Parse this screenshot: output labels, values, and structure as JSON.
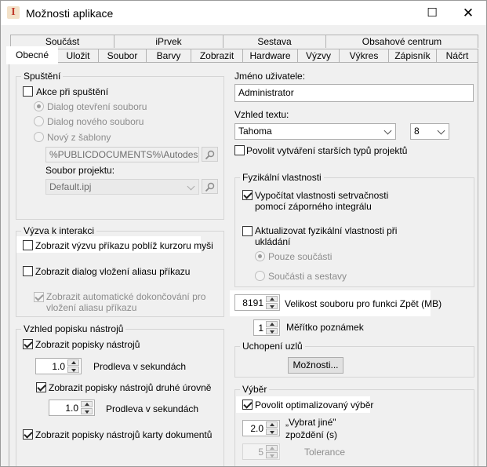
{
  "window": {
    "title": "Možnosti aplikace",
    "maximize_glyph": "☐",
    "close_glyph": "✕",
    "icon": "app-logo-icon"
  },
  "tabs": {
    "row1": [
      "Součást",
      "iPrvek",
      "Sestava",
      "Obsahové centrum"
    ],
    "row2": [
      "Obecné",
      "Uložit",
      "Soubor",
      "Barvy",
      "Zobrazit",
      "Hardware",
      "Výzvy",
      "Výkres",
      "Zápisník",
      "Náčrt"
    ],
    "active": "Obecné"
  },
  "startup": {
    "group_label": "Spuštění",
    "action_label": "Akce při spuštění",
    "radio_open": "Dialog otevření souboru",
    "radio_new": "Dialog nového souboru",
    "radio_template": "Nový z šablony",
    "template_path": "%PUBLICDOCUMENTS%\\Autodesk\\Inv",
    "project_file_label": "Soubor projektu:",
    "project_file_value": "Default.ipj"
  },
  "command_prompt": {
    "group_label": "Výzva k interakci",
    "near_cursor": "Zobrazit výzvu příkazu poblíž kurzoru myši",
    "alias_dialog": "Zobrazit dialog vložení aliasu příkazu",
    "autocomplete": "Zobrazit automatické dokončování pro vložení aliasu příkazu"
  },
  "tooltips": {
    "group_label": "Vzhled popisku nástrojů",
    "show": "Zobrazit popisky nástrojů",
    "delay1_value": "1.0",
    "delay_label": "Prodleva v sekundách",
    "second_level": "Zobrazit popisky nástrojů druhé úrovně",
    "delay2_value": "1.0",
    "doc_tabs": "Zobrazit popisky nástrojů karty dokumentů"
  },
  "user": {
    "label": "Jméno uživatele:",
    "value": "Administrator"
  },
  "text_appearance": {
    "label": "Vzhled textu:",
    "font": "Tahoma",
    "size": "8",
    "legacy": "Povolit vytváření starších typů projektů"
  },
  "physical": {
    "group_label": "Fyzikální vlastnosti",
    "calc_inertia": "Vypočítat vlastnosti setrvačnosti pomocí záporného integrálu",
    "update_on_save": "Aktualizovat fyzikální vlastnosti při ukládání",
    "parts_only": "Pouze součásti",
    "parts_and_assemblies": "Součásti a sestavy"
  },
  "undo": {
    "value": "8191",
    "label": "Velikost souboru pro funkci Zpět (MB)"
  },
  "annotation_scale": {
    "value": "1",
    "label": "Měřítko poznámek"
  },
  "snap": {
    "group_label": "Uchopení uzlů",
    "options_button": "Možnosti..."
  },
  "selection": {
    "group_label": "Výběr",
    "optimized": "Povolit optimalizovaný výběr",
    "select_other_value": "2.0",
    "select_other_label": "„Vybrat jiné\" zpoždění (s)",
    "tolerance_value": "5",
    "tolerance_label": "Tolerance"
  },
  "colors": {
    "accent_checkbox": "#1e1e1e",
    "highlight": "#ffffff",
    "title_icon": "#c0392b"
  }
}
